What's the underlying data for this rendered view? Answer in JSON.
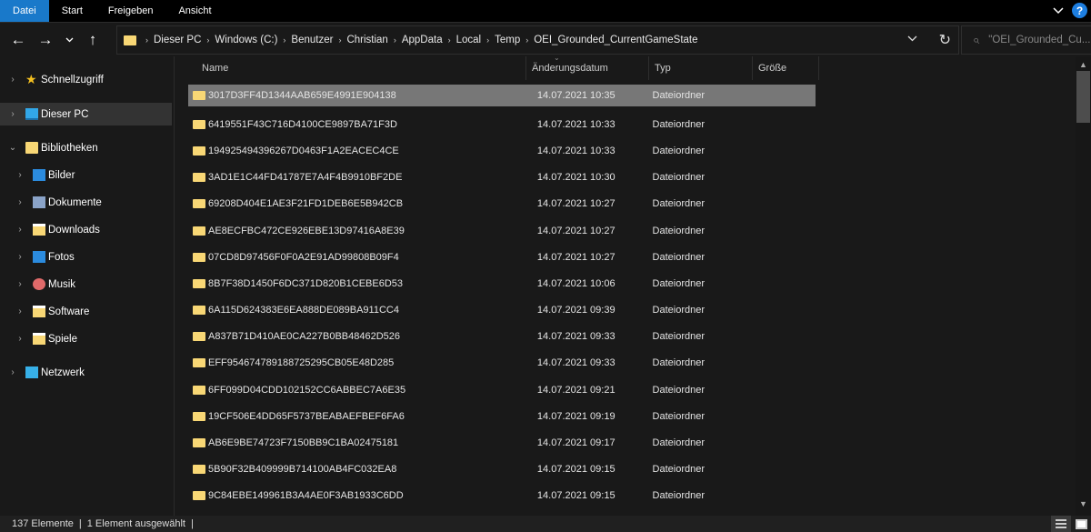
{
  "ribbon": {
    "tabs": [
      "Datei",
      "Start",
      "Freigeben",
      "Ansicht"
    ],
    "active_tab": "Datei",
    "help_label": "?"
  },
  "navigation": {
    "back": "←",
    "forward": "→",
    "recent": "⌄",
    "up": "↑"
  },
  "address_bar": {
    "breadcrumbs": [
      "Dieser PC",
      "Windows (C:)",
      "Benutzer",
      "Christian",
      "AppData",
      "Local",
      "Temp",
      "OEI_Grounded_CurrentGameState"
    ],
    "separator": "›",
    "dropdown": "⌄",
    "refresh": "↻"
  },
  "search": {
    "placeholder": "\"OEI_Grounded_Cu..."
  },
  "sidebar": {
    "items": [
      {
        "label": "Schnellzugriff",
        "icon": "star-icon",
        "chevron": "›"
      },
      {
        "label": "Dieser PC",
        "icon": "computer-icon",
        "chevron": "›",
        "selected": true
      },
      {
        "label": "Bibliotheken",
        "icon": "folder-icon",
        "chevron": "⌄"
      },
      {
        "label": "Bilder",
        "icon": "pictures-icon",
        "chevron": "›"
      },
      {
        "label": "Dokumente",
        "icon": "documents-icon",
        "chevron": "›"
      },
      {
        "label": "Downloads",
        "icon": "downloads-icon",
        "chevron": "›"
      },
      {
        "label": "Fotos",
        "icon": "photos-icon",
        "chevron": "›"
      },
      {
        "label": "Musik",
        "icon": "music-icon",
        "chevron": "›"
      },
      {
        "label": "Software",
        "icon": "library-folder-icon",
        "chevron": "›"
      },
      {
        "label": "Spiele",
        "icon": "library-folder-icon",
        "chevron": "›"
      },
      {
        "label": "Netzwerk",
        "icon": "network-icon",
        "chevron": "›"
      }
    ]
  },
  "file_list": {
    "columns": [
      "Name",
      "Änderungsdatum",
      "Typ",
      "Größe"
    ],
    "sort_indicator": "⌄",
    "rows": [
      {
        "name": "3017D3FF4D1344AAB659E4991E904138",
        "date": "14.07.2021 10:35",
        "type": "Dateiordner",
        "size": "",
        "selected": true
      },
      {
        "name": "6419551F43C716D4100CE9897BA71F3D",
        "date": "14.07.2021 10:33",
        "type": "Dateiordner",
        "size": ""
      },
      {
        "name": "194925494396267D0463F1A2EACEC4CE",
        "date": "14.07.2021 10:33",
        "type": "Dateiordner",
        "size": ""
      },
      {
        "name": "3AD1E1C44FD41787E7A4F4B9910BF2DE",
        "date": "14.07.2021 10:30",
        "type": "Dateiordner",
        "size": ""
      },
      {
        "name": "69208D404E1AE3F21FD1DEB6E5B942CB",
        "date": "14.07.2021 10:27",
        "type": "Dateiordner",
        "size": ""
      },
      {
        "name": "AE8ECFBC472CE926EBE13D97416A8E39",
        "date": "14.07.2021 10:27",
        "type": "Dateiordner",
        "size": ""
      },
      {
        "name": "07CD8D97456F0F0A2E91AD99808B09F4",
        "date": "14.07.2021 10:27",
        "type": "Dateiordner",
        "size": ""
      },
      {
        "name": "8B7F38D1450F6DC371D820B1CEBE6D53",
        "date": "14.07.2021 10:06",
        "type": "Dateiordner",
        "size": ""
      },
      {
        "name": "6A115D624383E6EA888DE089BA911CC4",
        "date": "14.07.2021 09:39",
        "type": "Dateiordner",
        "size": ""
      },
      {
        "name": "A837B71D410AE0CA227B0BB48462D526",
        "date": "14.07.2021 09:33",
        "type": "Dateiordner",
        "size": ""
      },
      {
        "name": "EFF954674789188725295CB05E48D285",
        "date": "14.07.2021 09:33",
        "type": "Dateiordner",
        "size": ""
      },
      {
        "name": "6FF099D04CDD102152CC6ABBEC7A6E35",
        "date": "14.07.2021 09:21",
        "type": "Dateiordner",
        "size": ""
      },
      {
        "name": "19CF506E4DD65F5737BEABAEFBEF6FA6",
        "date": "14.07.2021 09:19",
        "type": "Dateiordner",
        "size": ""
      },
      {
        "name": "AB6E9BE74723F7150BB9C1BA02475181",
        "date": "14.07.2021 09:17",
        "type": "Dateiordner",
        "size": ""
      },
      {
        "name": "5B90F32B409999B714100AB4FC032EA8",
        "date": "14.07.2021 09:15",
        "type": "Dateiordner",
        "size": ""
      },
      {
        "name": "9C84EBE149961B3A4AE0F3AB1933C6DD",
        "date": "14.07.2021 09:15",
        "type": "Dateiordner",
        "size": ""
      }
    ]
  },
  "status_bar": {
    "item_count": "137 Elemente",
    "selection": "1 Element ausgewählt",
    "separator": "|"
  },
  "colors": {
    "accent": "#1979ca",
    "folder": "#f8d775",
    "selection": "#777777",
    "background": "#191919"
  }
}
